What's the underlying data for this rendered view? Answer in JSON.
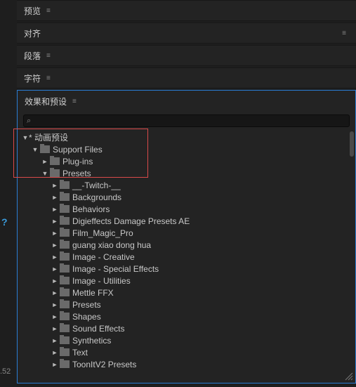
{
  "left": {
    "help": "?",
    "time": ".52"
  },
  "panels": [
    {
      "title": "预览",
      "menuLeft": "≡",
      "menuRight": ""
    },
    {
      "title": "对齐",
      "menuLeft": "",
      "menuRight": "≡"
    },
    {
      "title": "段落",
      "menuLeft": "≡",
      "menuRight": ""
    },
    {
      "title": "字符",
      "menuLeft": "≡",
      "menuRight": ""
    }
  ],
  "effects": {
    "title": "效果和预设",
    "menu": "≡",
    "search": {
      "icon": "⌕"
    }
  },
  "tree": {
    "root": {
      "label": "* 动画预设"
    },
    "support": {
      "label": "Support Files"
    },
    "plugins": {
      "label": "Plug-ins"
    },
    "presets": {
      "label": "Presets"
    },
    "children": [
      {
        "label": "__-Twitch-__"
      },
      {
        "label": "Backgrounds"
      },
      {
        "label": "Behaviors"
      },
      {
        "label": "Digieffects Damage Presets AE"
      },
      {
        "label": "Film_Magic_Pro"
      },
      {
        "label": "guang xiao dong hua"
      },
      {
        "label": "Image - Creative"
      },
      {
        "label": "Image - Special Effects"
      },
      {
        "label": "Image - Utilities"
      },
      {
        "label": "Mettle FFX"
      },
      {
        "label": "Presets"
      },
      {
        "label": "Shapes"
      },
      {
        "label": "Sound Effects"
      },
      {
        "label": "Synthetics"
      },
      {
        "label": "Text"
      },
      {
        "label": "ToonItV2 Presets"
      }
    ]
  }
}
